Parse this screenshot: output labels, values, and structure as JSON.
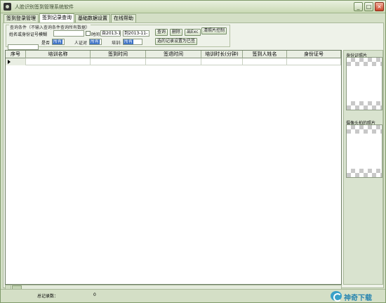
{
  "window": {
    "title": "人脸识别签到管理系统软件",
    "controls": {
      "minimize": "_",
      "maximize": "□",
      "close": "×"
    }
  },
  "tabs": [
    "签到登录管理",
    "签到记录查询",
    "基础数据设置",
    "在线帮助"
  ],
  "active_tab_index": 1,
  "query": {
    "legend": "查询条件（不输入查询条件查询所有数据）",
    "name_id_label": "姓名或身份证号模糊",
    "name_id_value": "",
    "time_checkbox_label": "时间",
    "date_from": "自2013-11-",
    "date_to": "到2013-11-",
    "pass_label": "是否",
    "pass_value": "所有",
    "auth_label": "人证对",
    "auth_value": "所有",
    "train_label": "培训:",
    "train_value": "所有",
    "buttons": {
      "query": "查询",
      "delete": "删除",
      "export": "出Exc",
      "clear_photo": "清照片控制",
      "save_setting": "选的记录设置为已签"
    }
  },
  "grid": {
    "columns": [
      "序号",
      "培训名称",
      "签到时间",
      "签退时间",
      "培训时长(分钟)",
      "签到人姓名",
      "身份证号"
    ]
  },
  "right_panel": {
    "id_photo_label": "身份证照片",
    "capture_photo_label": "摄像头拍的照片"
  },
  "status": {
    "total_label": "总记录数：",
    "total_value": "0"
  },
  "watermark": "神奇下载",
  "colors": {
    "chrome": "#d4dfc6",
    "selection_blue": "#3a6fc4",
    "close_red": "#c9452a"
  }
}
